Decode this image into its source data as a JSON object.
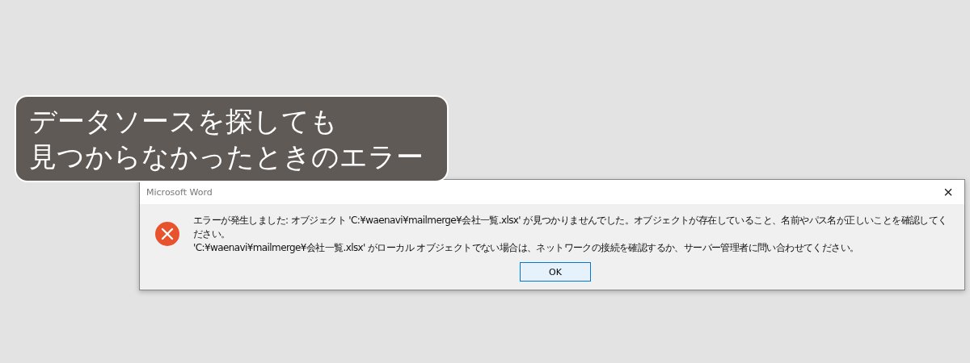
{
  "caption": {
    "lines": [
      "データソースを探しても",
      "見つからなかったときのエラー"
    ]
  },
  "dialog": {
    "title": "Microsoft Word",
    "close": "×",
    "message": [
      "エラーが発生しました: オブジェクト 'C:¥waenavi¥mailmerge¥会社一覧.xlsx' が見つかりませんでした。オブジェクトが存在していること、名前やパス名が正しいことを確認してください。",
      "'C:¥waenavi¥mailmerge¥会社一覧.xlsx' がローカル オブジェクトでない場合は、ネットワークの接続を確認するか、サーバー管理者に問い合わせてください。"
    ],
    "buttons": [
      {
        "label": "OK",
        "selected": true
      }
    ]
  }
}
